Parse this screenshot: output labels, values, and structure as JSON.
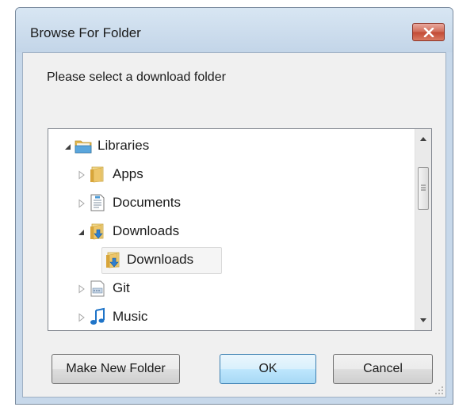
{
  "window": {
    "title": "Browse For Folder"
  },
  "dialog": {
    "prompt": "Please select a download folder"
  },
  "tree": {
    "items": [
      {
        "label": "Libraries",
        "icon": "libraries-icon",
        "state": "expanded"
      },
      {
        "label": "Apps",
        "icon": "folder-icon",
        "state": "collapsed"
      },
      {
        "label": "Documents",
        "icon": "documents-icon",
        "state": "collapsed"
      },
      {
        "label": "Downloads",
        "icon": "downloads-folder-icon",
        "state": "expanded"
      },
      {
        "label": "Downloads",
        "icon": "downloads-folder-icon",
        "state": "selected"
      },
      {
        "label": "Git",
        "icon": "git-icon",
        "state": "collapsed"
      },
      {
        "label": "Music",
        "icon": "music-icon",
        "state": "collapsed"
      }
    ]
  },
  "buttons": {
    "make_new_folder": "Make New Folder",
    "ok": "OK",
    "cancel": "Cancel"
  },
  "colors": {
    "titlebar": "#c7d8ea",
    "close_button": "#c94f3a",
    "default_button": "#bee6fd",
    "folder": "#e8c15a"
  }
}
